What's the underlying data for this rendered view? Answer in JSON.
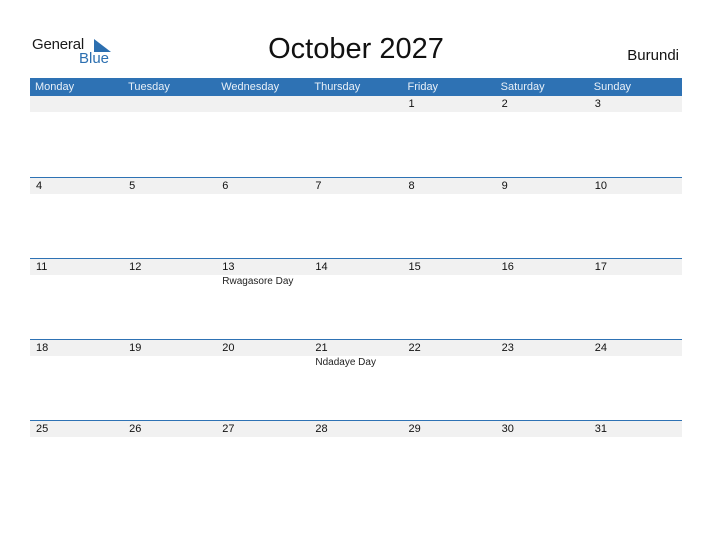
{
  "logo": {
    "line1": "General",
    "line2": "Blue"
  },
  "title": "October 2027",
  "country": "Burundi",
  "colors": {
    "accent": "#2e72b4",
    "strip": "#f1f1f1"
  },
  "weekdays": [
    "Monday",
    "Tuesday",
    "Wednesday",
    "Thursday",
    "Friday",
    "Saturday",
    "Sunday"
  ],
  "weeks": [
    [
      {
        "day": ""
      },
      {
        "day": ""
      },
      {
        "day": ""
      },
      {
        "day": ""
      },
      {
        "day": "1"
      },
      {
        "day": "2"
      },
      {
        "day": "3"
      }
    ],
    [
      {
        "day": "4"
      },
      {
        "day": "5"
      },
      {
        "day": "6"
      },
      {
        "day": "7"
      },
      {
        "day": "8"
      },
      {
        "day": "9"
      },
      {
        "day": "10"
      }
    ],
    [
      {
        "day": "11"
      },
      {
        "day": "12"
      },
      {
        "day": "13",
        "holiday": "Rwagasore Day"
      },
      {
        "day": "14"
      },
      {
        "day": "15"
      },
      {
        "day": "16"
      },
      {
        "day": "17"
      }
    ],
    [
      {
        "day": "18"
      },
      {
        "day": "19"
      },
      {
        "day": "20"
      },
      {
        "day": "21",
        "holiday": "Ndadaye Day"
      },
      {
        "day": "22"
      },
      {
        "day": "23"
      },
      {
        "day": "24"
      }
    ],
    [
      {
        "day": "25"
      },
      {
        "day": "26"
      },
      {
        "day": "27"
      },
      {
        "day": "28"
      },
      {
        "day": "29"
      },
      {
        "day": "30"
      },
      {
        "day": "31"
      }
    ]
  ]
}
